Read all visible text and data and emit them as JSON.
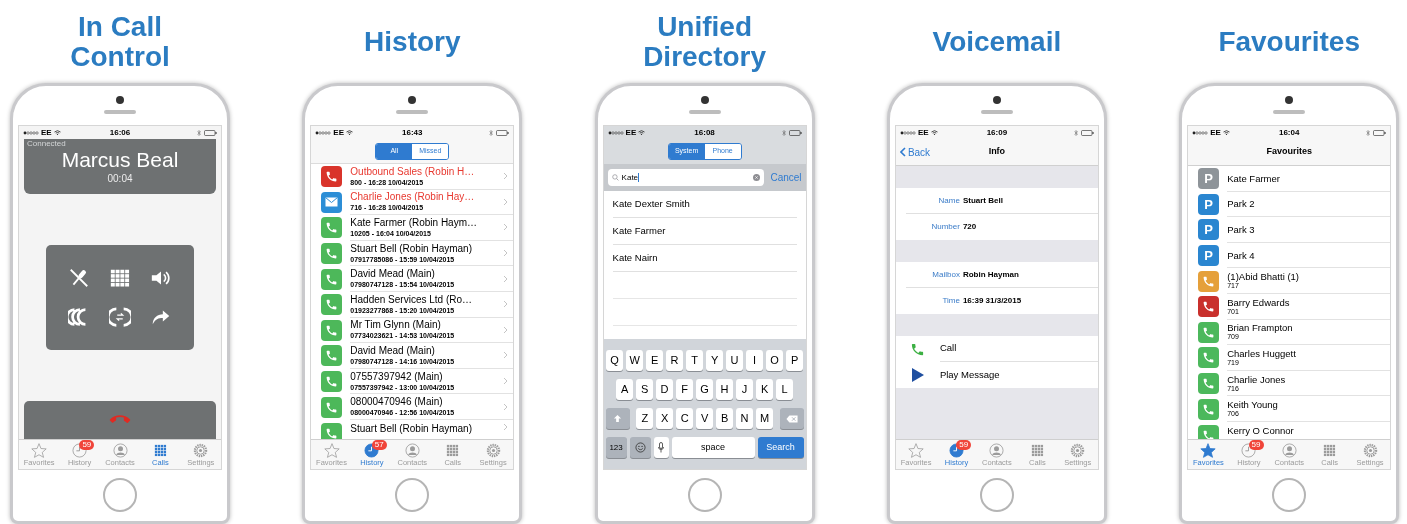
{
  "panels": [
    {
      "kind": "in_call",
      "title": "In Call Control",
      "status": {
        "carrier": "EE",
        "time": "16:06"
      },
      "call": {
        "state": "Connected",
        "name": "Marcus Beal",
        "duration": "00:04"
      },
      "tabs": [
        {
          "label": "Favorites",
          "selected": false
        },
        {
          "label": "History",
          "selected": false,
          "badge": "59"
        },
        {
          "label": "Contacts",
          "selected": false
        },
        {
          "label": "Calls",
          "selected": true
        },
        {
          "label": "Settings",
          "selected": false
        }
      ]
    },
    {
      "kind": "history",
      "title": "History",
      "status": {
        "carrier": "EE",
        "time": "16:43"
      },
      "segments": [
        {
          "label": "All",
          "selected": true
        },
        {
          "label": "Missed",
          "selected": false
        }
      ],
      "rows": [
        {
          "kind": "missed",
          "name": "Outbound Sales (Robin H…",
          "detail": "800 - 16:28 10/04/2015",
          "missed": true
        },
        {
          "kind": "voicemail",
          "name": "Charlie Jones (Robin Hay…",
          "detail": "716 - 16:28 10/04/2015",
          "missed": true
        },
        {
          "kind": "call",
          "name": "Kate Farmer (Robin Haym…",
          "detail": "10205 - 16:04 10/04/2015",
          "missed": false
        },
        {
          "kind": "call",
          "name": "Stuart Bell (Robin Hayman)",
          "detail": "07917785086 - 15:59 10/04/2015",
          "missed": false
        },
        {
          "kind": "call",
          "name": "David Mead (Main)",
          "detail": "07980747128 - 15:54 10/04/2015",
          "missed": false
        },
        {
          "kind": "call",
          "name": "Hadden Services Ltd (Ro…",
          "detail": "01923277868 - 15:20 10/04/2015",
          "missed": false
        },
        {
          "kind": "call",
          "name": "Mr Tim Glynn (Main)",
          "detail": "07734023621 - 14:53 10/04/2015",
          "missed": false
        },
        {
          "kind": "call",
          "name": "David Mead (Main)",
          "detail": "07980747128 - 14:16 10/04/2015",
          "missed": false
        },
        {
          "kind": "call",
          "name": "07557397942 (Main)",
          "detail": "07557397942 - 13:00 10/04/2015",
          "missed": false
        },
        {
          "kind": "call",
          "name": "08000470946 (Main)",
          "detail": "08000470946 - 12:56 10/04/2015",
          "missed": false
        },
        {
          "kind": "call",
          "name": "Stuart Bell (Robin Hayman)",
          "missed": false
        }
      ],
      "tabs": [
        {
          "label": "Favorites",
          "selected": false
        },
        {
          "label": "History",
          "selected": true,
          "badge": "57"
        },
        {
          "label": "Contacts",
          "selected": false
        },
        {
          "label": "Calls",
          "selected": false
        },
        {
          "label": "Settings",
          "selected": false
        }
      ]
    },
    {
      "kind": "directory",
      "title": "Unified Directory",
      "status": {
        "carrier": "EE",
        "time": "16:08"
      },
      "segments": [
        {
          "label": "System",
          "selected": true
        },
        {
          "label": "Phone",
          "selected": false
        }
      ],
      "search": {
        "value": "Kate",
        "action": "Cancel"
      },
      "results": [
        "Kate Dexter Smith",
        "Kate Farmer",
        "Kate Nairn"
      ],
      "keys": [
        [
          "Q",
          "W",
          "E",
          "R",
          "T",
          "Y",
          "U",
          "I",
          "O",
          "P"
        ],
        [
          "A",
          "S",
          "D",
          "F",
          "G",
          "H",
          "J",
          "K",
          "L"
        ],
        [
          "Z",
          "X",
          "C",
          "V",
          "B",
          "N",
          "M"
        ]
      ],
      "keys_bottom": {
        "numbers": "123",
        "space": "space",
        "action": "Search"
      }
    },
    {
      "kind": "voicemail",
      "title": "Voicemail",
      "status": {
        "carrier": "EE",
        "time": "16:09"
      },
      "nav": {
        "back": "Back",
        "title": "Info"
      },
      "groups": [
        [
          {
            "label": "Name",
            "value": "Stuart Bell"
          },
          {
            "label": "Number",
            "value": "720"
          }
        ],
        [
          {
            "label": "Mailbox",
            "value": "Robin Hayman"
          },
          {
            "label": "Time",
            "value": "16:39 31/3/2015"
          }
        ]
      ],
      "actions": [
        {
          "kind": "call",
          "label": "Call"
        },
        {
          "kind": "play",
          "label": "Play Message"
        }
      ],
      "tabs": [
        {
          "label": "Favorites",
          "selected": false
        },
        {
          "label": "History",
          "selected": true,
          "badge": "59"
        },
        {
          "label": "Contacts",
          "selected": false
        },
        {
          "label": "Calls",
          "selected": false
        },
        {
          "label": "Settings",
          "selected": false
        }
      ]
    },
    {
      "kind": "favourites",
      "title": "Favourites",
      "status": {
        "carrier": "EE",
        "time": "16:04"
      },
      "nav": {
        "title": "Favourites"
      },
      "rows": [
        {
          "kind": "park",
          "icon_text": "P",
          "color": "#8e9499",
          "name": "Kate Farmer"
        },
        {
          "kind": "park",
          "icon_text": "P",
          "color": "#2a86d0",
          "name": "Park 2"
        },
        {
          "kind": "park",
          "icon_text": "P",
          "color": "#2a86d0",
          "name": "Park 3"
        },
        {
          "kind": "park",
          "icon_text": "P",
          "color": "#2a86d0",
          "name": "Park 4"
        },
        {
          "kind": "contact",
          "color": "#e5a03a",
          "name": "(1)Abid Bhatti (1)",
          "number": "717"
        },
        {
          "kind": "contact",
          "color": "#c9302c",
          "name": "Barry Edwards",
          "number": "701"
        },
        {
          "kind": "contact",
          "color": "#4cb85c",
          "name": "Brian Frampton",
          "number": "709"
        },
        {
          "kind": "contact",
          "color": "#4cb85c",
          "name": "Charles Huggett",
          "number": "719"
        },
        {
          "kind": "contact",
          "color": "#4cb85c",
          "name": "Charlie Jones",
          "number": "716"
        },
        {
          "kind": "contact",
          "color": "#4cb85c",
          "name": "Keith Young",
          "number": "706"
        },
        {
          "kind": "contact",
          "color": "#4cb85c",
          "name": "Kerry O Connor"
        }
      ],
      "tabs": [
        {
          "label": "Favorites",
          "selected": true
        },
        {
          "label": "History",
          "selected": false,
          "badge": "59"
        },
        {
          "label": "Contacts",
          "selected": false
        },
        {
          "label": "Calls",
          "selected": false
        },
        {
          "label": "Settings",
          "selected": false
        }
      ]
    }
  ]
}
